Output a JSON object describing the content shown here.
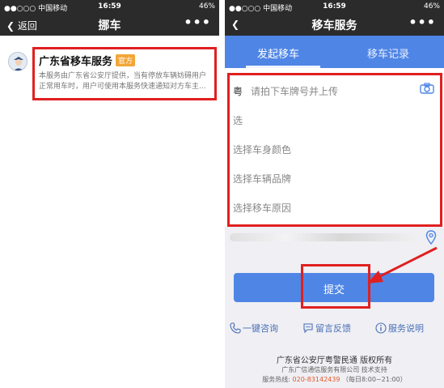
{
  "status": {
    "carrier": "●●○○○ 中国移动",
    "time": "16:59",
    "battery": "46%"
  },
  "left": {
    "nav": {
      "back": "返回",
      "title": "挪车",
      "more": "•••"
    },
    "card": {
      "title": "广东省移车服务",
      "badge": "官方",
      "desc": "本服务由广东省公安厅提供，当有停放车辆妨碍用户正常用车时，用户可使用本服务快速通知对方车主..."
    }
  },
  "right": {
    "nav": {
      "back": "",
      "title": "移车服务",
      "more": "•••"
    },
    "tabs": [
      "发起移车",
      "移车记录"
    ],
    "form": {
      "province": "粤",
      "plate_placeholder": "请拍下车牌号并上传",
      "row2": "选",
      "color": "选择车身颜色",
      "brand": "选择车辆品牌",
      "reason": "选择移车原因"
    },
    "submit": "提交",
    "links": [
      "一键咨询",
      "留言反馈",
      "服务说明"
    ],
    "footer": {
      "line1": "广东省公安厅粤警民通 版权所有",
      "line2": "广东广信通信服务有限公司 技术支持",
      "hotline_label": "服务热线:",
      "hotline": "020-83142439",
      "hours": "（每日8:00~21:00）"
    }
  },
  "colors": {
    "accent": "#4f86e6",
    "highlight": "#e02020",
    "badge": "#f3a638",
    "bar": "#2b2b2b"
  }
}
